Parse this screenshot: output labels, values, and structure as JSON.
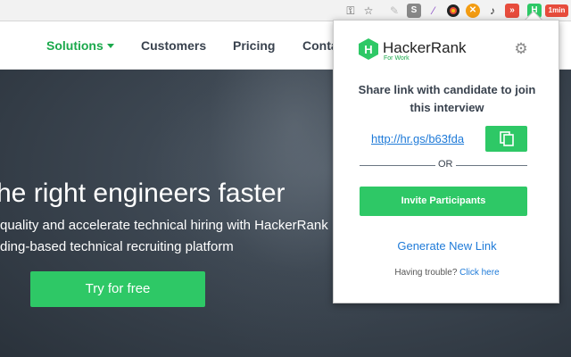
{
  "browser": {
    "toolbar_icons": [
      "key-icon",
      "star-icon",
      "extension-icons"
    ],
    "extension_badge": "1min"
  },
  "site_nav": {
    "items": [
      {
        "label": "Solutions",
        "active": true
      },
      {
        "label": "Customers"
      },
      {
        "label": "Pricing"
      },
      {
        "label": "Conta"
      }
    ]
  },
  "hero": {
    "headline": "he right engineers faster",
    "subline_1": "quality and accelerate technical hiring with HackerRank",
    "subline_2": "ding-based technical recruiting platform",
    "cta_label": "Try for free"
  },
  "popup": {
    "logo_text": "HackerRank",
    "logo_sub": "For Work",
    "logo_letter": "H",
    "share_text": "Share link with candidate to join this interview",
    "share_link": "http://hr.gs/b63fda",
    "or_label": "OR",
    "invite_label": "Invite Participants",
    "generate_label": "Generate New Link",
    "trouble_text": "Having trouble?",
    "trouble_link": "Click here"
  },
  "colors": {
    "brand_green": "#2ec866",
    "nav_active": "#1ba94c",
    "link_blue": "#1e7ad8",
    "text_dark": "#39424e"
  }
}
